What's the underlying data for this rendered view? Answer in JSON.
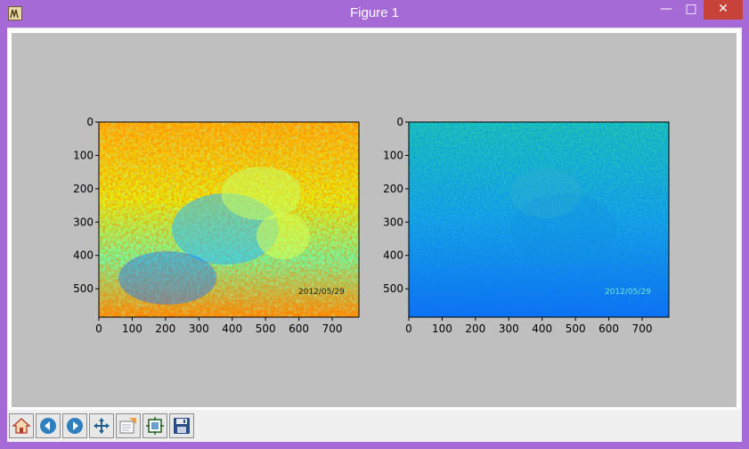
{
  "window": {
    "title": "Figure 1"
  },
  "controls": {
    "minimize": "—",
    "maximize": "□",
    "close": "✕"
  },
  "figure": {
    "left_axes": {
      "xticks": [
        "0",
        "100",
        "200",
        "300",
        "400",
        "500",
        "600",
        "700"
      ],
      "yticks": [
        "0",
        "100",
        "200",
        "300",
        "400",
        "500"
      ],
      "timestamp": "2012/05/29",
      "colormap": "jet"
    },
    "right_axes": {
      "xticks": [
        "0",
        "100",
        "200",
        "300",
        "400",
        "500",
        "600",
        "700"
      ],
      "yticks": [
        "0",
        "100",
        "200",
        "300",
        "400",
        "500"
      ],
      "timestamp": "2012/05/29",
      "colormap": "jet"
    }
  },
  "toolbar": {
    "items": [
      {
        "name": "home",
        "icon": "home-icon"
      },
      {
        "name": "back",
        "icon": "back-arrow-icon"
      },
      {
        "name": "forward",
        "icon": "forward-arrow-icon"
      },
      {
        "name": "pan",
        "icon": "move-arrows-icon"
      },
      {
        "name": "zoom",
        "icon": "zoom-rect-icon"
      },
      {
        "name": "subplots",
        "icon": "configure-subplots-icon"
      },
      {
        "name": "save",
        "icon": "floppy-disk-icon"
      }
    ]
  }
}
